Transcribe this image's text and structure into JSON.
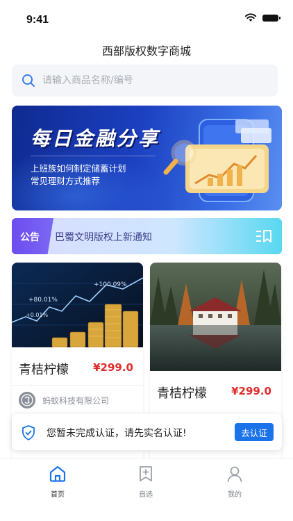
{
  "status_bar": {
    "time": "9:41"
  },
  "header": {
    "title": "西部版权数字商城"
  },
  "search": {
    "placeholder": "请输入商品名称/编号"
  },
  "banner": {
    "title": "每日金融分享",
    "line1": "上班族如何制定储蓄计划",
    "line2": "常见理财方式推荐"
  },
  "notice": {
    "tag": "公告",
    "text": "巴蜀文明版权上新通知"
  },
  "products": [
    {
      "name": "青桔柠檬",
      "price": "¥299.0",
      "seller": "蚂蚁科技有限公司"
    },
    {
      "name": "青桔柠檬",
      "price": "¥299.0"
    }
  ],
  "chart_labels": {
    "a": "+100.09%",
    "b": "+80.01%",
    "c": "+0.01%"
  },
  "verify": {
    "text": "您暂未完成认证，请先实名认证!",
    "button": "去认证"
  },
  "tabbar": {
    "items": [
      {
        "label": "首页",
        "icon": "home-icon"
      },
      {
        "label": "自选",
        "icon": "bookmark-add-icon"
      },
      {
        "label": "我的",
        "icon": "user-icon"
      }
    ]
  },
  "colors": {
    "accent": "#1a73e8",
    "price": "#e02b2b",
    "notice_tag": "#6d4cf0"
  }
}
